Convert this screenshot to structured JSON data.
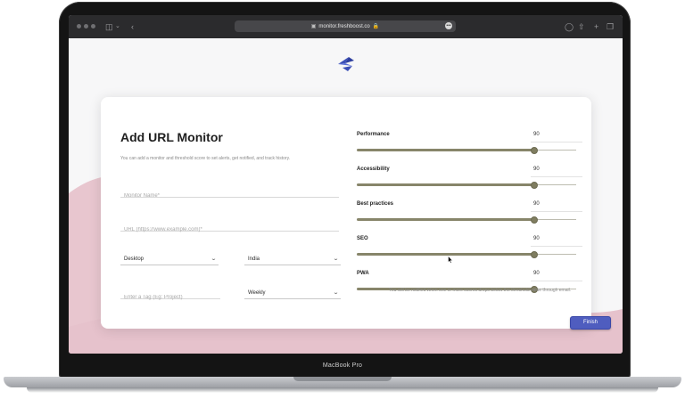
{
  "browser": {
    "url": "monitor.freshboost.co",
    "lock_icon": "lock-icon",
    "sidebar_icon": "sidebar-toggle-icon",
    "back_icon": "chevron-left-icon"
  },
  "device": {
    "label": "MacBook Pro"
  },
  "page": {
    "title": "Add URL Monitor",
    "description": "You can add a monitor and threshold score to set alerts, get notified, and track history.",
    "fields": {
      "name_placeholder": "Monitor Name*",
      "url_placeholder": "URL (https://www.example.com)*",
      "tag_placeholder": "Enter a Tag (Eg: Project)"
    },
    "selects": {
      "device": "Desktop",
      "country": "India",
      "frequency": "Weekly"
    },
    "metrics": [
      {
        "label": "Performance",
        "value": "90",
        "level": 0.9
      },
      {
        "label": "Accessibility",
        "value": "90",
        "level": 0.9
      },
      {
        "label": "Best practices",
        "value": "90",
        "level": 0.9
      },
      {
        "label": "SEO",
        "value": "90",
        "level": 0.9
      },
      {
        "label": "PWA",
        "value": "90",
        "level": 0.9
      }
    ],
    "notify_text": "You will be notified when one or more scores drops below the threshold value through email.",
    "finish_label": "Finish"
  },
  "colors": {
    "accent": "#4f5dbf",
    "slider": "#87856a",
    "background_wave": "#e9c9d2",
    "logo": "#3b4fb8"
  }
}
